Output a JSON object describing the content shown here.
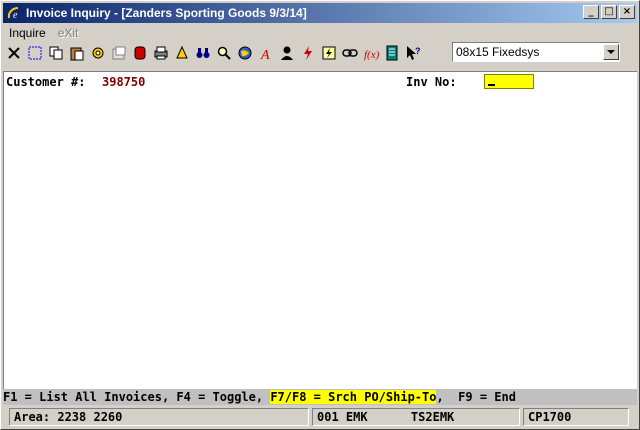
{
  "window": {
    "title": "Invoice Inquiry - [Zanders Sporting Goods 9/3/14]",
    "minimize_glyph": "_",
    "maximize_glyph": "□",
    "close_glyph": "×"
  },
  "menu": {
    "items": [
      {
        "label": "Inquire",
        "enabled": true
      },
      {
        "label": "eXit",
        "enabled": false
      }
    ]
  },
  "toolbar": {
    "icons": [
      "cut-x-icon",
      "select-icon",
      "copy-icon",
      "paste-icon",
      "settings-gear-icon",
      "properties-icon",
      "stop-icon",
      "printer-icon",
      "bell-icon",
      "binoculars-icon",
      "magnifier-icon",
      "globe-icon",
      "font-a-icon",
      "user-icon",
      "lightning-icon",
      "macro-icon",
      "link-icon",
      "function-icon",
      "list-icon",
      "help-pointer-icon"
    ],
    "font_select": {
      "value": "08x15 Fixedsys"
    }
  },
  "terminal": {
    "customer_label": "Customer #:",
    "customer_value": "398750",
    "inv_label": "Inv No:",
    "inv_value": ""
  },
  "function_keys": {
    "part1": "F1 = List All Invoices, F4 = Toggle, ",
    "part2_highlight": "F7/F8 = Srch PO/Ship-To",
    "part3": ",  F9 = End"
  },
  "status": {
    "area": "Area: 2238 2260",
    "session": "001 EMK      TS2EMK",
    "code": "CP1700"
  },
  "colors": {
    "title_start": "#0a246a",
    "title_end": "#a6caf0",
    "customer_value": "#800000",
    "highlight": "#ffff00"
  }
}
